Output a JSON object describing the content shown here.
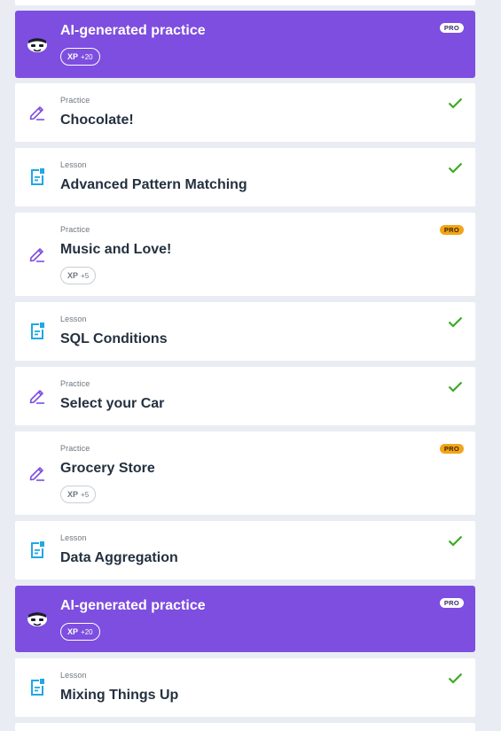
{
  "colors": {
    "ai_card": "#7d4ee0",
    "check": "#3cab24",
    "pro_badge": "#f3a418",
    "practice_icon": "#7d4ee0",
    "lesson_icon": "#1fa7e6"
  },
  "items": [
    {
      "type": "ai",
      "title": "AI-generated practice",
      "xp_label": "XP",
      "xp_value": "+20",
      "badge": "PRO",
      "icon": "ai-robot-icon"
    },
    {
      "type": "practice",
      "kind": "Practice",
      "title": "Chocolate!",
      "status": "completed",
      "icon": "pencil-icon"
    },
    {
      "type": "lesson",
      "kind": "Lesson",
      "title": "Advanced Pattern Matching",
      "status": "completed",
      "icon": "lesson-doc-icon"
    },
    {
      "type": "practice",
      "kind": "Practice",
      "title": "Music and Love!",
      "badge": "PRO",
      "xp_label": "XP",
      "xp_value": "+5",
      "icon": "pencil-icon"
    },
    {
      "type": "lesson",
      "kind": "Lesson",
      "title": "SQL Conditions",
      "status": "completed",
      "icon": "lesson-doc-icon"
    },
    {
      "type": "practice",
      "kind": "Practice",
      "title": "Select your Car",
      "status": "completed",
      "icon": "pencil-icon"
    },
    {
      "type": "practice",
      "kind": "Practice",
      "title": "Grocery Store",
      "badge": "PRO",
      "xp_label": "XP",
      "xp_value": "+5",
      "icon": "pencil-icon"
    },
    {
      "type": "lesson",
      "kind": "Lesson",
      "title": "Data Aggregation",
      "status": "completed",
      "icon": "lesson-doc-icon"
    },
    {
      "type": "ai",
      "title": "AI-generated practice",
      "xp_label": "XP",
      "xp_value": "+20",
      "badge": "PRO",
      "icon": "ai-robot-icon"
    },
    {
      "type": "lesson",
      "kind": "Lesson",
      "title": "Mixing Things Up",
      "status": "completed",
      "icon": "lesson-doc-icon"
    }
  ]
}
